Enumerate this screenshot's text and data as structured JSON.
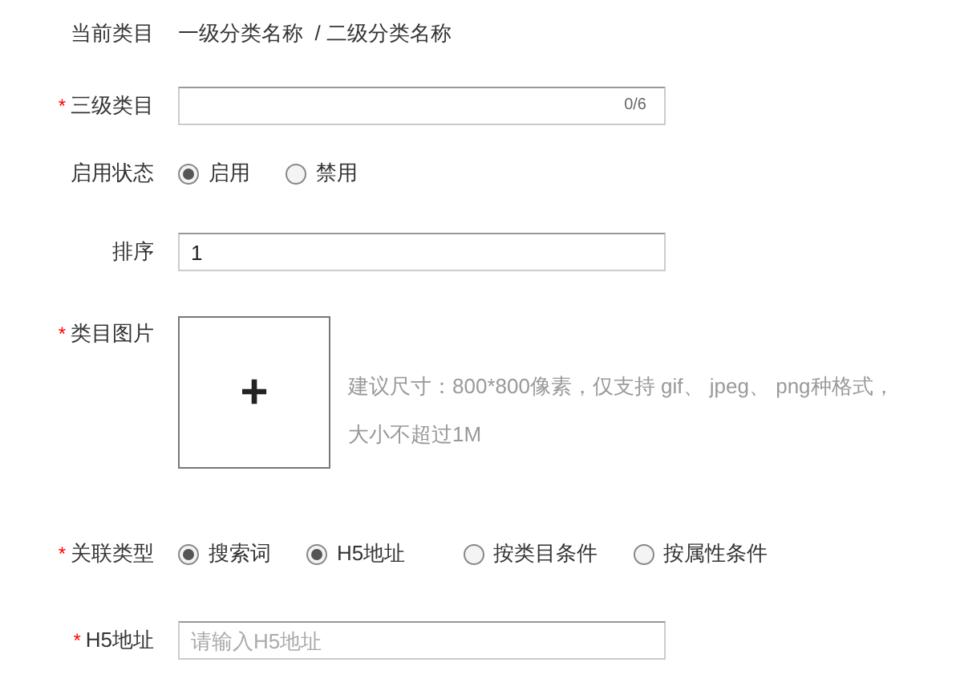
{
  "rows": [
    {
      "kind": "text",
      "label": "当前类目",
      "value": "一级分类名称  / 二级分类名称"
    },
    {
      "kind": "input",
      "label": "三级类目",
      "required_mark": "*",
      "value": "",
      "placeholder": "",
      "counter": "0/6"
    },
    {
      "kind": "radio",
      "label": "启用状态",
      "options": [
        {
          "label": "启用",
          "selected": true
        },
        {
          "label": "禁用",
          "selected": false
        }
      ]
    },
    {
      "kind": "input",
      "label": "排序",
      "value": "1"
    },
    {
      "kind": "upload",
      "label": "类目图片",
      "required_mark": "*",
      "button": "+",
      "hint": [
        "建议尺寸：800*800像素，仅支持 gif、 jpeg、 png种格式，",
        "大小不超过1M"
      ]
    },
    {
      "kind": "radio",
      "label": "关联类型",
      "required_mark": "*",
      "options": [
        {
          "label": "搜索词",
          "selected": true
        },
        {
          "label": "H5地址",
          "selected": true
        },
        {
          "label": "按类目条件",
          "selected": false
        },
        {
          "label": "按属性条件",
          "selected": false
        }
      ]
    },
    {
      "kind": "input",
      "label": "H5地址",
      "required_mark": "*",
      "value": "",
      "placeholder": "请输入H5地址"
    }
  ]
}
